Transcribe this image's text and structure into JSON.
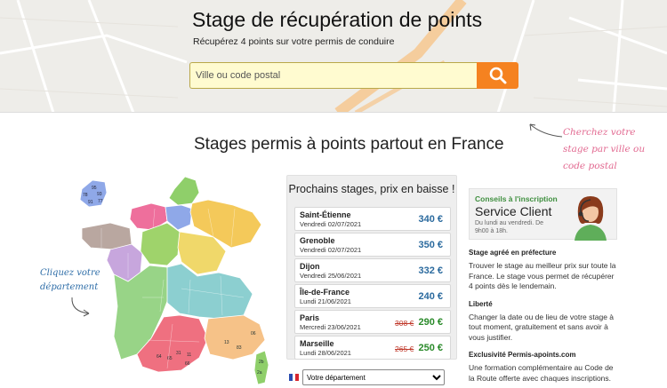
{
  "hero": {
    "title": "Stage de récupération de points",
    "subtitle": "Récupérez 4 points sur votre permis de conduire",
    "search_placeholder": "Ville ou code postal",
    "search_icon": "magnifier-icon"
  },
  "section": {
    "title": "Stages permis à points partout en France"
  },
  "hints": {
    "right": "Cherchez votre stage par ville ou code postal",
    "left": "Cliquez votre département"
  },
  "map": {
    "idf_labels": [
      "95",
      "78",
      "93",
      "91",
      "77"
    ],
    "south_labels": [
      "64",
      "65",
      "31",
      "11",
      "66",
      "13",
      "83",
      "06"
    ],
    "corse_labels": [
      "2b",
      "2a"
    ]
  },
  "stages": {
    "title": "Prochains stages, prix en baisse !",
    "items": [
      {
        "city": "Saint-Étienne",
        "date": "Vendredi 02/07/2021",
        "old": "",
        "price": "340 €",
        "green": false
      },
      {
        "city": "Grenoble",
        "date": "Vendredi 02/07/2021",
        "old": "",
        "price": "350 €",
        "green": false
      },
      {
        "city": "Dijon",
        "date": "Vendredi 25/06/2021",
        "old": "",
        "price": "332 €",
        "green": false
      },
      {
        "city": "Île-de-France",
        "date": "Lundi 21/06/2021",
        "old": "",
        "price": "240 €",
        "green": false
      },
      {
        "city": "Paris",
        "date": "Mercredi 23/06/2021",
        "old": "308 €",
        "price": "290 €",
        "green": true
      },
      {
        "city": "Marseille",
        "date": "Lundi 28/06/2021",
        "old": "265 €",
        "price": "250 €",
        "green": true
      }
    ],
    "select_value": "Votre département"
  },
  "service": {
    "label": "Conseils à l'inscription",
    "title": "Service Client",
    "hours": "Du lundi au vendredi. De 9h00 à 18h."
  },
  "info": [
    {
      "heading": "Stage agréé en préfecture",
      "text": "Trouver le stage au meilleur prix sur toute la France. Le stage vous permet de récupérer 4 points dès le lendemain."
    },
    {
      "heading": "Liberté",
      "text": "Changer la date ou de lieu de votre stage à tout moment, gratuitement et sans avoir à vous justifier."
    },
    {
      "heading": "Exclusivité Permis-apoints.com",
      "text": "Une formation complémentaire au Code de la Route offerte avec chaques inscriptions."
    }
  ],
  "colors": {
    "accent": "#f58220",
    "price_blue": "#2b6a9e",
    "price_green": "#2a8a2a",
    "hint_pink": "#e26a91",
    "hint_blue": "#2f6ea8"
  }
}
